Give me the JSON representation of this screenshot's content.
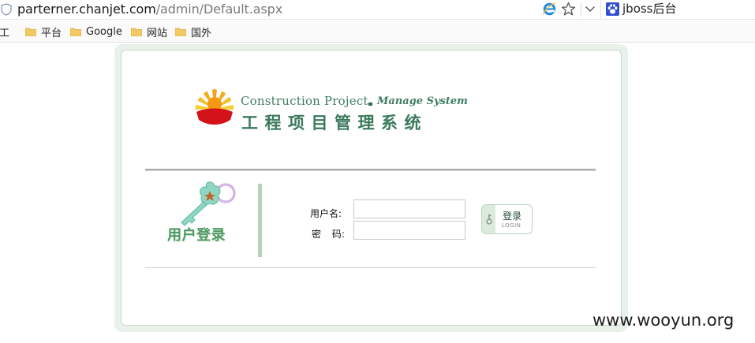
{
  "addressbar": {
    "url_host": "parterner.chanjet.com",
    "url_path": "/admin/Default.aspx",
    "extension_label": "jboss后台",
    "icons": [
      "shield-icon",
      "ie-icon",
      "star-icon",
      "chevron-down-icon",
      "paw-icon"
    ]
  },
  "bookmarks": [
    {
      "label": "社工",
      "icon": "folder-icon"
    },
    {
      "label": "平台",
      "icon": "folder-icon"
    },
    {
      "label": "Google",
      "icon": "folder-icon"
    },
    {
      "label": "网站",
      "icon": "folder-icon"
    },
    {
      "label": "国外",
      "icon": "folder-icon"
    }
  ],
  "logo": {
    "en_main": "Construction Project",
    "en_sub": "Manage System",
    "cn": "工程项目管理系统"
  },
  "login": {
    "title": "用户登录",
    "username_label": "用户名:",
    "username_value": "",
    "password_label": "密 码:",
    "password_value": "",
    "button_label": "登录",
    "button_sublabel": "LOGIN"
  },
  "watermark": "www.wooyun.org",
  "colors": {
    "brand_green": "#3f7d62",
    "panel_bg": "#e9f2ea",
    "accent_bar": "#b4d2b6"
  }
}
